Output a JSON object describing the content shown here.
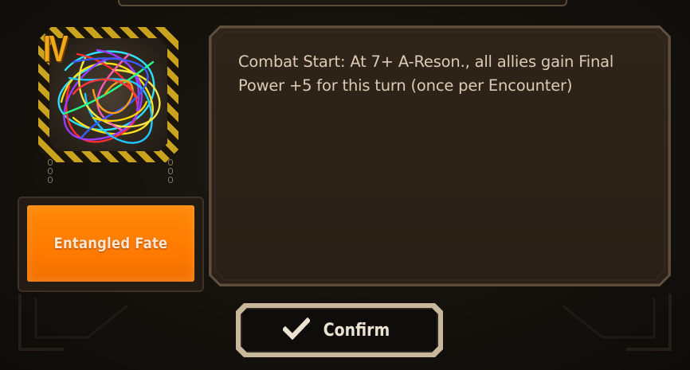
{
  "effect": {
    "tier": "IV",
    "icon": "tangled-threads-icon",
    "name": "Entangled Fate",
    "description": "Combat Start: At 7+ A-Reson., all allies gain Final Power +5 for this turn (once per Encounter)"
  },
  "confirm_button": {
    "label": "Confirm",
    "icon": "checkmark-icon"
  },
  "colors": {
    "accent_orange": "#ff7f05",
    "hazard_yellow": "#c9a21e",
    "panel_bg": "#2d2218",
    "text": "#dccab4"
  }
}
